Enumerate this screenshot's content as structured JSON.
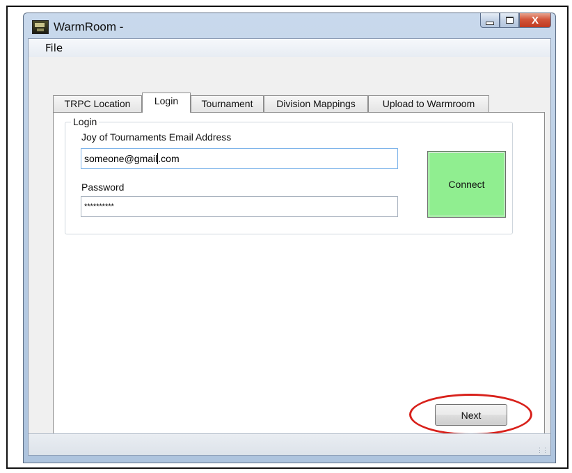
{
  "window": {
    "title": "WarmRoom -",
    "icon": "warmroom-app-icon",
    "close_glyph": "X"
  },
  "menu": {
    "file": "File"
  },
  "tabs": [
    {
      "label": "TRPC Location",
      "active": false
    },
    {
      "label": "Login",
      "active": true
    },
    {
      "label": "Tournament",
      "active": false
    },
    {
      "label": "Division Mappings",
      "active": false
    },
    {
      "label": "Upload to Warmroom",
      "active": false
    }
  ],
  "login": {
    "group_title": "Login",
    "email_label": "Joy of Tournaments Email Address",
    "email_value_before_caret": "someone@gmail",
    "email_value_after_caret": ".com",
    "password_label": "Password",
    "password_value": "**********",
    "connect_label": "Connect"
  },
  "footer": {
    "next_label": "Next"
  },
  "colors": {
    "connect_bg": "#90ee90",
    "highlight": "#d8211b"
  }
}
